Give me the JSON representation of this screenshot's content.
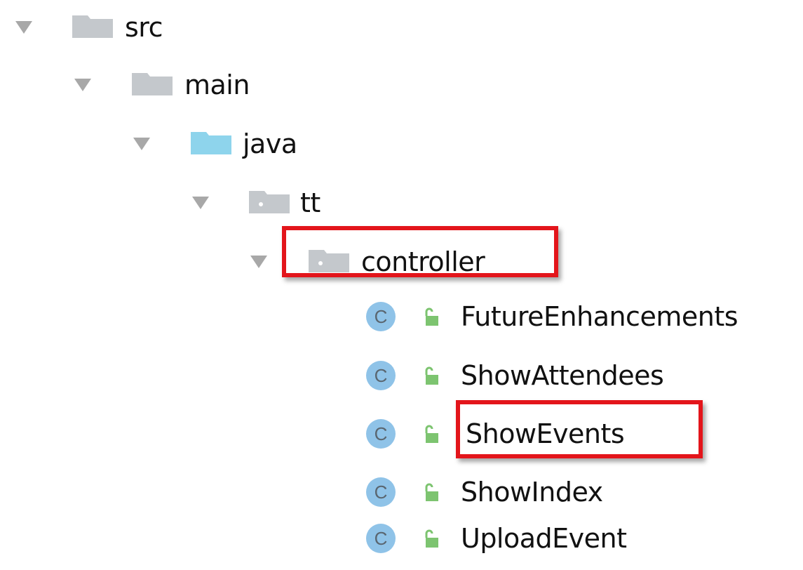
{
  "tree": {
    "folders": [
      {
        "label": "src",
        "icon": "folder-gray-icon"
      },
      {
        "label": "main",
        "icon": "folder-gray-icon"
      },
      {
        "label": "java",
        "icon": "folder-blue-icon"
      },
      {
        "label": "tt",
        "icon": "package-icon"
      },
      {
        "label": "controller",
        "icon": "package-icon"
      }
    ],
    "classes": [
      {
        "label": "FutureEnhancements",
        "icon_letter": "C"
      },
      {
        "label": "ShowAttendees",
        "icon_letter": "C"
      },
      {
        "label": "ShowEvents",
        "icon_letter": "C"
      },
      {
        "label": "ShowIndex",
        "icon_letter": "C"
      },
      {
        "label": "UploadEvent",
        "icon_letter": "C"
      }
    ]
  },
  "highlights": [
    "controller",
    "ShowEvents"
  ],
  "colors": {
    "folder_gray": "#c4c8cc",
    "folder_blue": "#8ed4ec",
    "class_icon": "#8fc3e8",
    "access_icon": "#7dc470",
    "highlight": "#e3151b",
    "expander": "#a8a8a8"
  }
}
